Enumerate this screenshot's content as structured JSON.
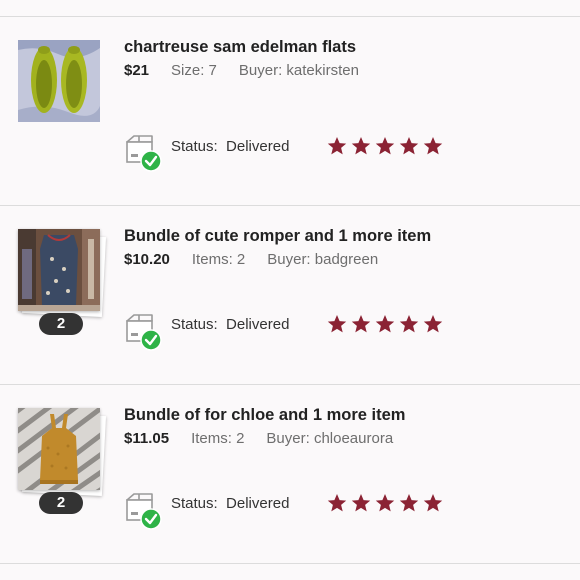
{
  "colors": {
    "star": "#8b2334",
    "check": "#2eb347",
    "badge": "#333333",
    "divider": "#dcdcdc",
    "background": "#fbf9fa"
  },
  "orders": [
    {
      "title": "chartreuse sam edelman flats",
      "price": "$21",
      "qty": "Size: 7",
      "buyer": "Buyer: katekirsten",
      "status_label": "Status:",
      "status_value": "Delivered",
      "rating": 5,
      "is_bundle": false,
      "bundle_count": ""
    },
    {
      "title": "Bundle of cute romper and 1 more item",
      "price": "$10.20",
      "qty": "Items: 2",
      "buyer": "Buyer: badgreen",
      "status_label": "Status:",
      "status_value": "Delivered",
      "rating": 5,
      "is_bundle": true,
      "bundle_count": "2"
    },
    {
      "title": "Bundle of for chloe and 1 more item",
      "price": "$11.05",
      "qty": "Items: 2",
      "buyer": "Buyer: chloeaurora",
      "status_label": "Status:",
      "status_value": "Delivered",
      "rating": 5,
      "is_bundle": true,
      "bundle_count": "2"
    }
  ]
}
